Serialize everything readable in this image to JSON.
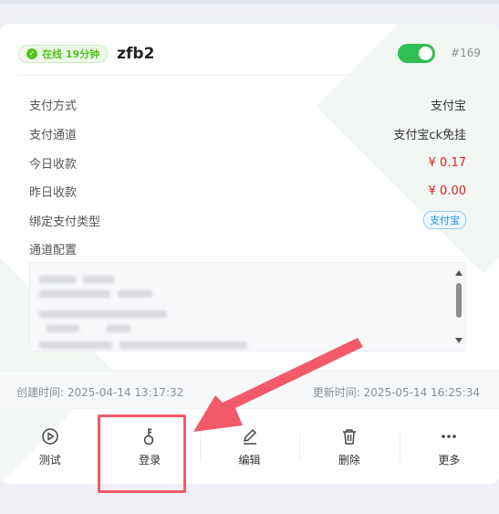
{
  "card": {
    "status_badge": "在线 19分钟",
    "name": "zfb2",
    "toggle_on": true,
    "id_tag": "#169",
    "fields": [
      {
        "label": "支付方式",
        "value": "支付宝"
      },
      {
        "label": "支付通道",
        "value": "支付宝ck免挂"
      },
      {
        "label": "今日收款",
        "value": "¥ 0.17"
      },
      {
        "label": "昨日收款",
        "value": "¥ 0.00"
      },
      {
        "label": "绑定支付类型",
        "value": "支付宝"
      },
      {
        "label": "通道配置",
        "value": ""
      }
    ],
    "created": "创建时间: 2025-04-14 13:17:32",
    "updated": "更新时间: 2025-05-14 16:25:34",
    "actions": [
      {
        "label": "测试",
        "icon": "play-circle-icon"
      },
      {
        "label": "登录",
        "icon": "key-icon"
      },
      {
        "label": "编辑",
        "icon": "pen-icon"
      },
      {
        "label": "删除",
        "icon": "trash-icon"
      },
      {
        "label": "更多",
        "icon": "more-dots-icon"
      }
    ]
  },
  "colors": {
    "accent_green": "#2fbf52",
    "amount_red": "#e02020",
    "annotation_red": "#f25a6a",
    "tag_blue": "#1890ff"
  }
}
